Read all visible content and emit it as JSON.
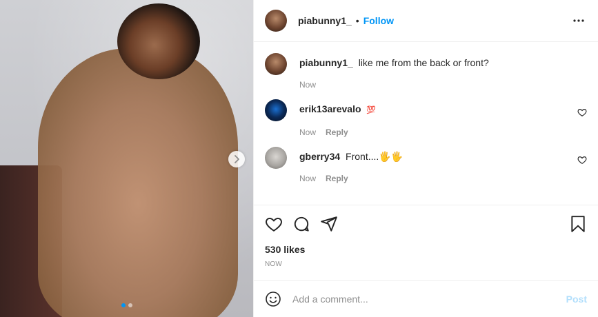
{
  "post": {
    "username": "piabunny1_",
    "separator": "•",
    "follow_label": "Follow",
    "more_icon": "more-horizontal-icon"
  },
  "media": {
    "next_icon": "chevron-right-icon",
    "carousel_total": 2,
    "carousel_active": 1
  },
  "caption": {
    "username": "piabunny1_",
    "text": "like me from the back or front?",
    "time": "Now"
  },
  "comments": [
    {
      "username": "erik13arevalo",
      "text": "💯",
      "time": "Now",
      "reply_label": "Reply"
    },
    {
      "username": "gberry34",
      "text": "Front....🖐🖐",
      "time": "Now",
      "reply_label": "Reply"
    }
  ],
  "actions": {
    "icons": [
      "heart-icon",
      "comment-icon",
      "share-icon",
      "bookmark-icon"
    ]
  },
  "likes": "530 likes",
  "posted": "NOW",
  "add_comment": {
    "placeholder": "Add a comment...",
    "post_label": "Post",
    "emoji_icon": "smiley-icon"
  },
  "colors": {
    "accent": "#0095f6",
    "muted": "#8e8e8e",
    "text": "#262626",
    "post_disabled": "#b2dffc"
  }
}
